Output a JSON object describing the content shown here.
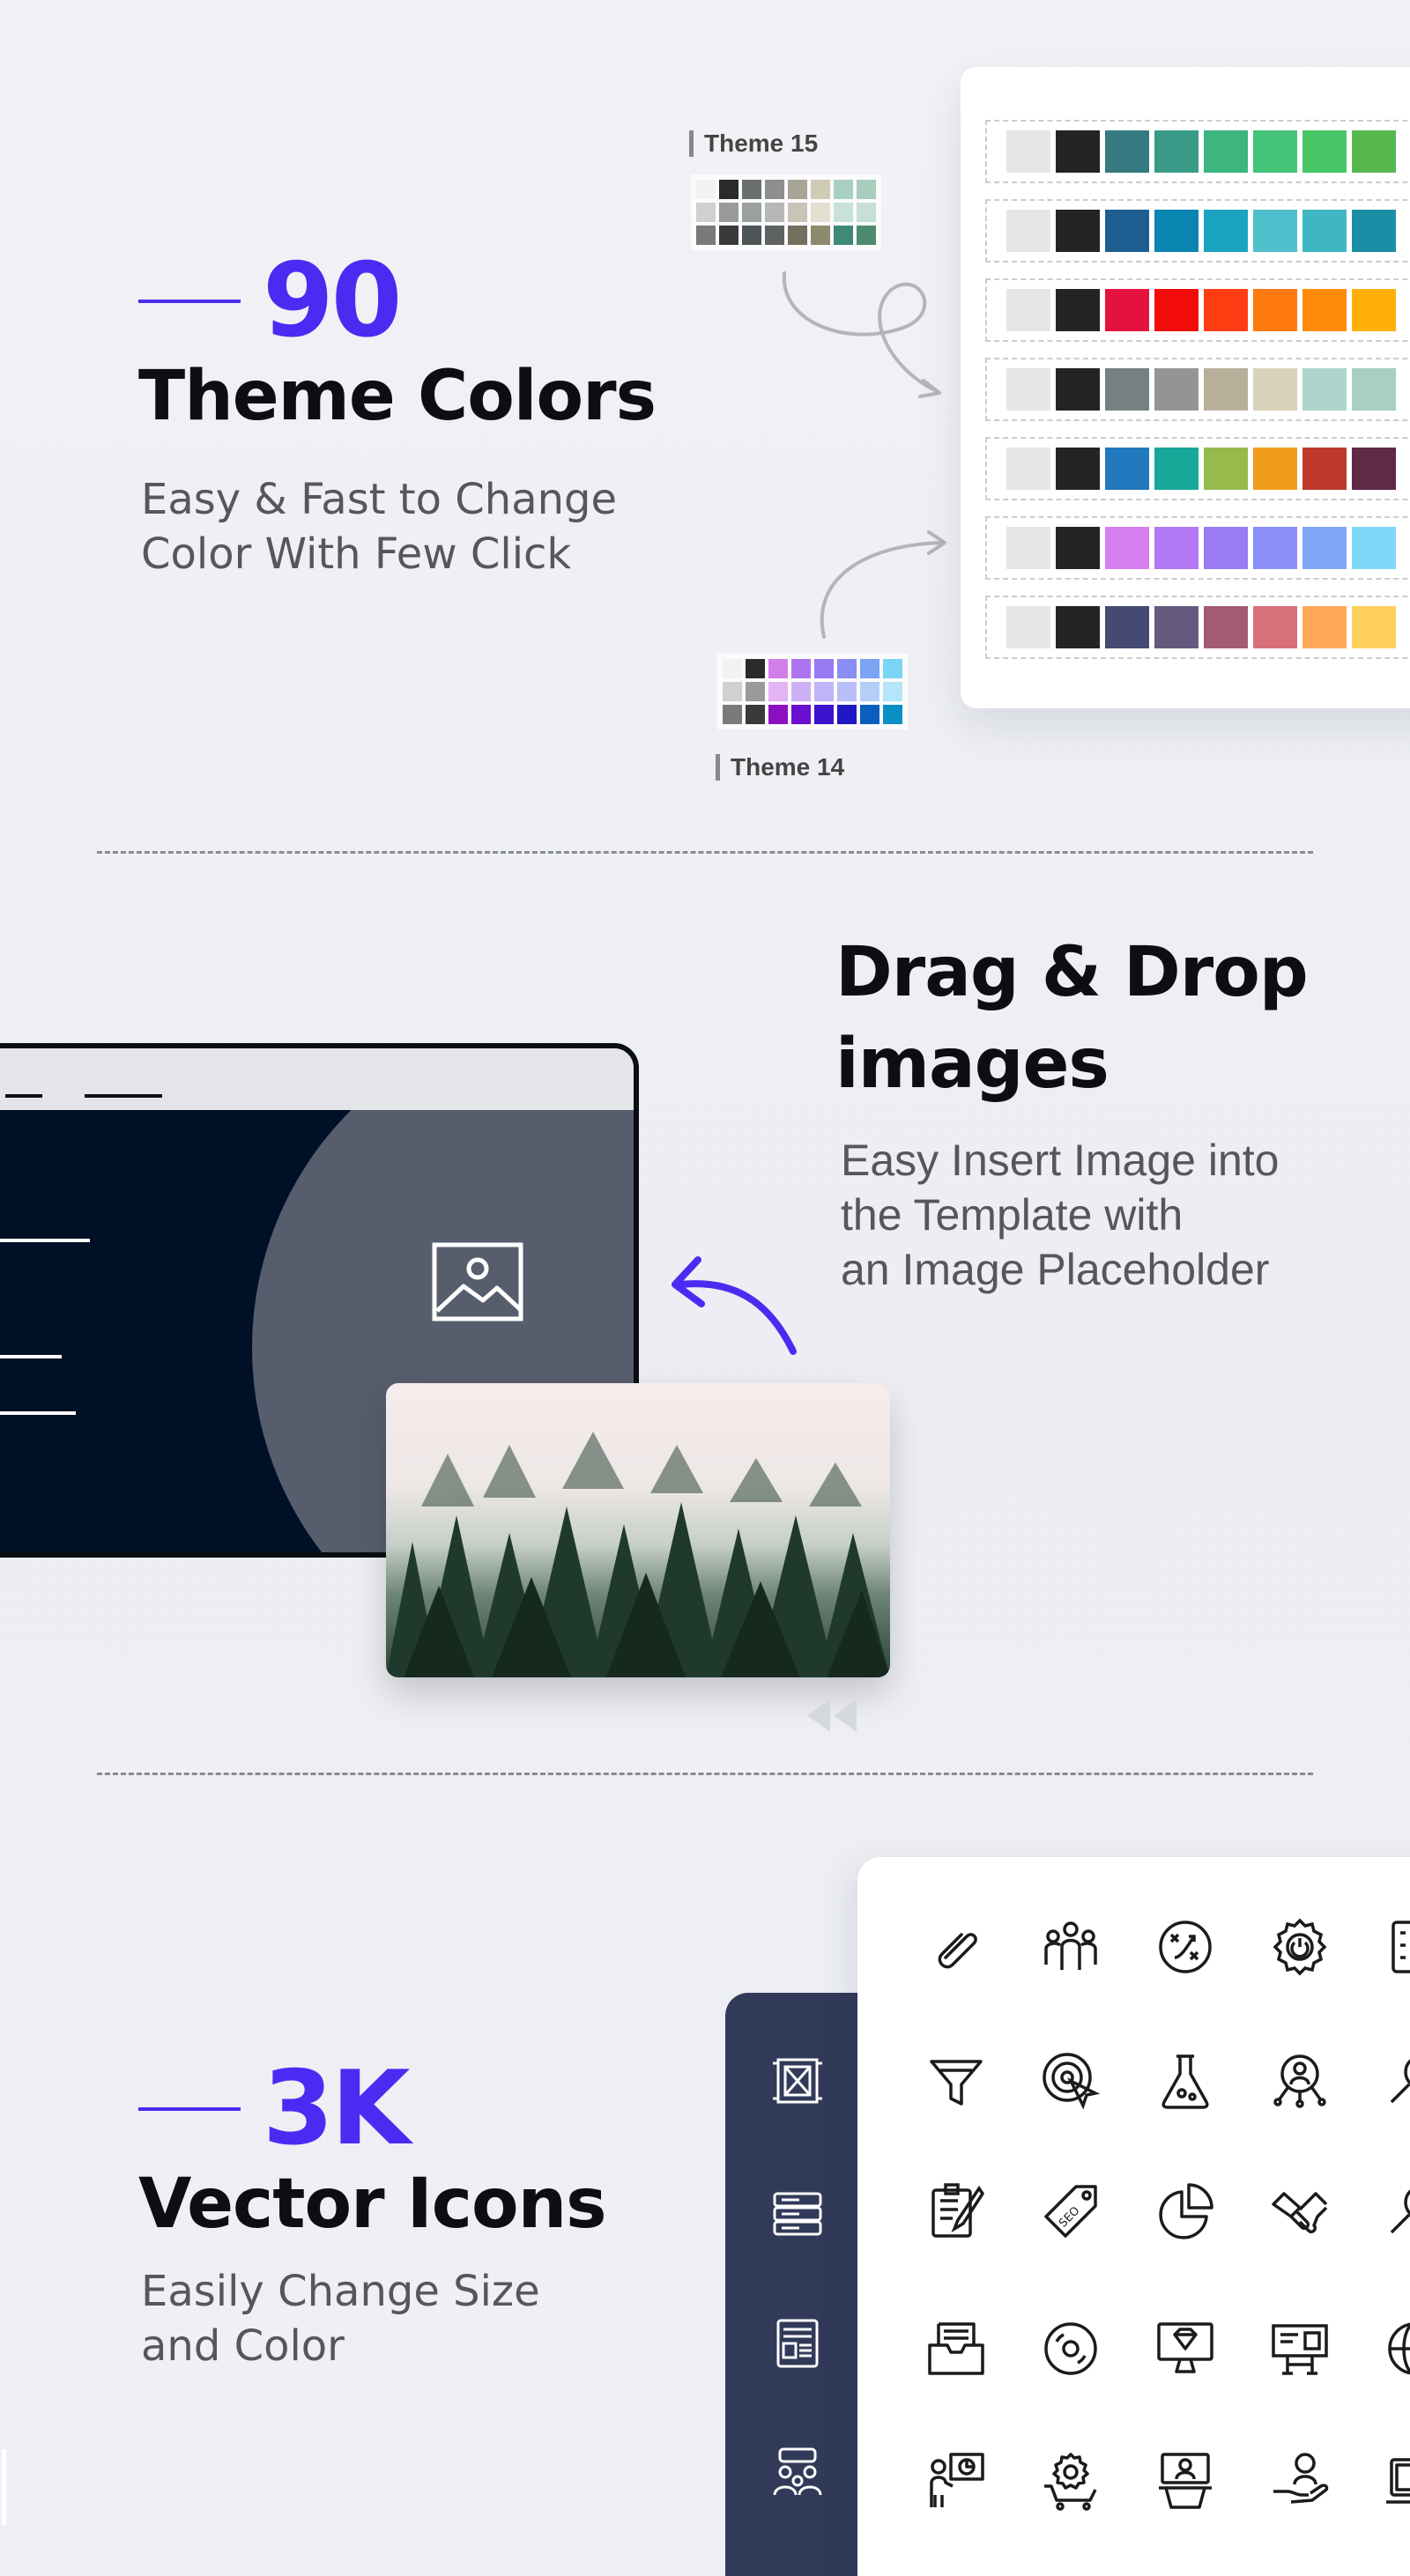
{
  "section_theme": {
    "number": "90",
    "title": "Theme Colors",
    "subtitle_lines": [
      "Easy & Fast to Change",
      "Color With Few Click"
    ],
    "theme_labels": [
      "Theme 15",
      "Theme 14"
    ],
    "palettes": [
      [
        "#e6e6e6",
        "#242424",
        "#347a80",
        "#3a9a88",
        "#3db57f",
        "#45c47a",
        "#48c766",
        "#58b850"
      ],
      [
        "#e6e6e6",
        "#242424",
        "#1e5d8f",
        "#0a84b0",
        "#1aa3c0",
        "#4fc0cb",
        "#3fb7c2",
        "#1a8ea4"
      ],
      [
        "#e6e6e6",
        "#242424",
        "#e5123f",
        "#f20b0b",
        "#ff3d12",
        "#ff7a0e",
        "#ff8a0b",
        "#ffae0a"
      ],
      [
        "#e6e6e6",
        "#242424",
        "#768081",
        "#949494",
        "#b8af9a",
        "#d8d2ba",
        "#add5cb",
        "#a8cfbf"
      ],
      [
        "#e6e6e6",
        "#242424",
        "#2178bd",
        "#17a89a",
        "#97ba4d",
        "#f09d1e",
        "#bf3a2d",
        "#5e2a47"
      ],
      [
        "#e6e6e6",
        "#242424",
        "#d67ff0",
        "#b277f3",
        "#9a7bf4",
        "#8b8ff5",
        "#7fa7f6",
        "#7fd8f7"
      ],
      [
        "#e6e6e6",
        "#242424",
        "#454a72",
        "#655a7e",
        "#a45a74",
        "#d8707c",
        "#ffa85a",
        "#ffd05c"
      ]
    ],
    "mini_theme_15": [
      "#f2f2f2",
      "#2a2a2a",
      "#6a6f72",
      "#8c8f8d",
      "#a9a596",
      "#cfcbb5",
      "#a9cfc4",
      "#a7cdbd",
      "#d0d0d0",
      "#9a9a9a",
      "#9aa0a2",
      "#b5b8b6",
      "#c8c5b8",
      "#e2dfcf",
      "#c8e2da",
      "#c6e0d6",
      "#7a7a7a",
      "#3a3a3a",
      "#4e5558",
      "#5e6260",
      "#74705f",
      "#8e8a6e",
      "#3e8a76",
      "#4e8a70"
    ],
    "mini_theme_14": [
      "#f2f2f2",
      "#2a2a2a",
      "#d17ee9",
      "#ae74f0",
      "#9779f2",
      "#8a8df3",
      "#7ba4f4",
      "#7bd4f3",
      "#d0d0d0",
      "#9a9a9a",
      "#e3b3f3",
      "#cdb0f6",
      "#c1b3f7",
      "#b8bef8",
      "#b3cff8",
      "#b2e6f8",
      "#7a7a7a",
      "#3a3a3a",
      "#8e0fc2",
      "#6a0fd0",
      "#3c12cf",
      "#2018c4",
      "#0a5fbe",
      "#0a8ec3"
    ],
    "accent_color": "#4b2bf2"
  },
  "section_drag": {
    "title_lines": [
      "Drag & Drop",
      "images"
    ],
    "subtitle_lines": [
      "Easy Insert Image into",
      "the Template with",
      "an Image Placeholder"
    ],
    "icons": [
      "image-placeholder-icon",
      "curved-arrow-icon",
      "rewind-icon"
    ]
  },
  "section_icons": {
    "number": "3K",
    "title": "Vector Icons",
    "subtitle_lines": [
      "Easily Change Size",
      "and Color"
    ],
    "grid_icons": [
      [
        "paperclip-icon",
        "team-icon",
        "strategy-icon",
        "gear-power-icon",
        "checklist-icon"
      ],
      [
        "funnel-icon",
        "target-click-icon",
        "flask-icon",
        "user-network-icon",
        "magnifier-icon"
      ],
      [
        "document-edit-icon",
        "seo-tag-icon",
        "pie-chart-icon",
        "handshake-icon",
        "magnifier-icon"
      ],
      [
        "inbox-tray-icon",
        "disc-icon",
        "monitor-diamond-icon",
        "billboard-icon",
        "globe-icon"
      ],
      [
        "presenter-chart-icon",
        "cart-gear-icon",
        "podium-user-icon",
        "hand-user-icon",
        "laptop-icon"
      ]
    ],
    "side_icons": [
      "frame-icon",
      "server-icon",
      "newspaper-icon",
      "group-chat-icon"
    ]
  }
}
